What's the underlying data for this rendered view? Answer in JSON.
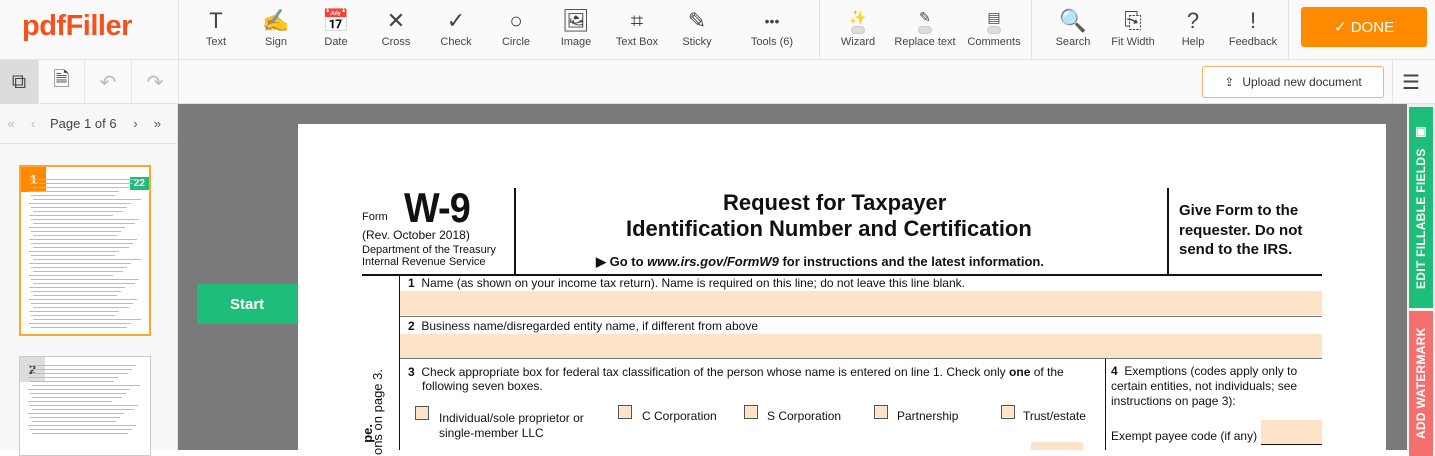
{
  "app": {
    "logo": "pdfFiller"
  },
  "toolbar": {
    "tools": [
      {
        "label": "Text",
        "icon": "text-icon",
        "glyph": "T"
      },
      {
        "label": "Sign",
        "icon": "sign-icon",
        "glyph": "✍"
      },
      {
        "label": "Date",
        "icon": "date-icon",
        "glyph": "📅"
      },
      {
        "label": "Cross",
        "icon": "cross-icon",
        "glyph": "✕"
      },
      {
        "label": "Check",
        "icon": "check-icon",
        "glyph": "✓"
      },
      {
        "label": "Circle",
        "icon": "circle-icon",
        "glyph": "○"
      },
      {
        "label": "Image",
        "icon": "image-icon",
        "glyph": "🖼"
      },
      {
        "label": "Text Box",
        "icon": "text-box-icon",
        "glyph": "⌗"
      },
      {
        "label": "Sticky",
        "icon": "sticky-icon",
        "glyph": "✎"
      },
      {
        "label": "Tools (6)",
        "icon": "more-icon",
        "glyph": "•••"
      }
    ],
    "toggles": [
      {
        "label": "Wizard",
        "icon": "wand-icon",
        "glyph": "✨"
      },
      {
        "label": "Replace text",
        "icon": "replace-text-icon",
        "glyph": "✎"
      },
      {
        "label": "Comments",
        "icon": "comment-icon",
        "glyph": "▤"
      }
    ],
    "right": [
      {
        "label": "Search",
        "icon": "search-icon",
        "glyph": "🔍"
      },
      {
        "label": "Fit Width",
        "icon": "fit-width-icon",
        "glyph": "⎘"
      },
      {
        "label": "Help",
        "icon": "help-icon",
        "glyph": "?"
      },
      {
        "label": "Feedback",
        "icon": "feedback-icon",
        "glyph": "!"
      }
    ],
    "done_label": "✓ DONE"
  },
  "toolbar2": {
    "upload_label": "Upload new document"
  },
  "pager": {
    "label": "Page",
    "current": "1",
    "of": "of 6"
  },
  "thumbs": [
    {
      "num": "1",
      "badge": "22"
    },
    {
      "num": "2"
    }
  ],
  "start_label": "Start",
  "side_tabs": {
    "edit": "EDIT FILLABLE FIELDS",
    "watermark": "ADD WATERMARK"
  },
  "form": {
    "form_label": "Form",
    "form_name": "W-9",
    "rev": "(Rev. October 2018)",
    "dept": "Department of the Treasury",
    "irs": "Internal Revenue Service",
    "title1": "Request for Taxpayer",
    "title2": "Identification Number and Certification",
    "goto_pre": "▶ Go to ",
    "goto_url": "www.irs.gov/FormW9",
    "goto_post": " for instructions and the latest information.",
    "give1": "Give Form to the",
    "give2": "requester. Do not",
    "give3": "send to the IRS.",
    "line1": "Name (as shown on your income tax return). Name is required on this line; do not leave this line blank.",
    "line2": "Business name/disregarded entity name, if different from above",
    "line3a": "Check appropriate box for federal tax classification of the person whose name is entered on line 1. Check only ",
    "line3b": "one",
    "line3c": " of the",
    "line3d": "following seven boxes.",
    "n1": "1",
    "n2": "2",
    "n3": "3",
    "n4": "4",
    "boxes": [
      "Individual/sole proprietor or",
      "single-member LLC",
      "C Corporation",
      "S Corporation",
      "Partnership",
      "Trust/estate"
    ],
    "line4a": "Exemptions (codes apply only to",
    "line4b": "certain entities, not individuals; see",
    "line4c": "instructions on page 3):",
    "exempt": "Exempt payee code (if any)",
    "side_a": "ons on page 3.",
    "side_b": "pe."
  }
}
